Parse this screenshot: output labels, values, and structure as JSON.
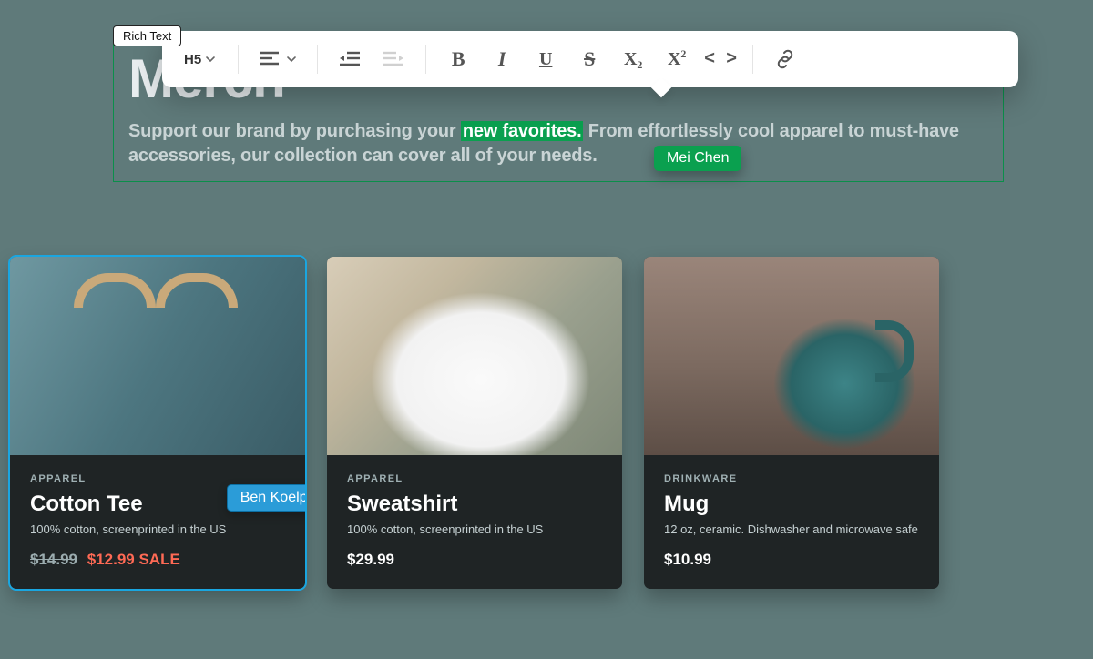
{
  "editor": {
    "block_label": "Rich Text",
    "toolbar": {
      "heading_label": "H5"
    }
  },
  "hero": {
    "title": "Merch",
    "subtitle_pre": "Support our brand by purchasing your ",
    "subtitle_highlight": "new favorites.",
    "subtitle_post": " From effortlessly cool apparel to must-have accessories, our collection can cover all of your needs."
  },
  "collaborators": {
    "text_cursor_user": "Mei Chen",
    "card_cursor_user": "Ben Koelpin"
  },
  "products": [
    {
      "category": "APPAREL",
      "name": "Cotton Tee",
      "description": "100% cotton, screenprinted in the US",
      "price_original": "$14.99",
      "price_sale": "$12.99 SALE",
      "on_sale": true
    },
    {
      "category": "APPAREL",
      "name": "Sweatshirt",
      "description": "100% cotton, screenprinted in the US",
      "price": "$29.99"
    },
    {
      "category": "DRINKWARE",
      "name": "Mug",
      "description": "12 oz, ceramic. Dishwasher and microwave safe",
      "price": "$10.99"
    }
  ]
}
